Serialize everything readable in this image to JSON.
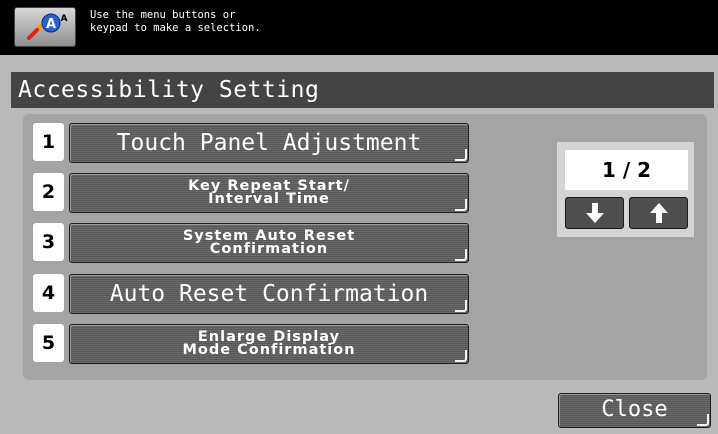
{
  "message": {
    "icon": "accessibility-icon",
    "text": "Use the menu buttons or\nkeypad to make a selection."
  },
  "screen": {
    "title": "Accessibility Setting"
  },
  "menu": {
    "items": [
      {
        "number": "1",
        "label": "Touch Panel Adjustment"
      },
      {
        "number": "2",
        "label": "Key Repeat Start/\nInterval Time"
      },
      {
        "number": "3",
        "label": "System Auto Reset\nConfirmation"
      },
      {
        "number": "4",
        "label": "Auto Reset Confirmation"
      },
      {
        "number": "5",
        "label": "Enlarge Display\nMode Confirmation"
      }
    ]
  },
  "pagination": {
    "page_indicator": "1 / 2",
    "current_page": 1,
    "total_pages": 2,
    "down_icon": "arrow-down-icon",
    "up_icon": "arrow-up-icon"
  },
  "footer": {
    "close_label": "Close"
  },
  "colors": {
    "background": "#b9b9b9",
    "message_bar": "#000000",
    "title_bar": "#444444",
    "panel": "#a4a4a4",
    "button": "#5f5f5f"
  }
}
